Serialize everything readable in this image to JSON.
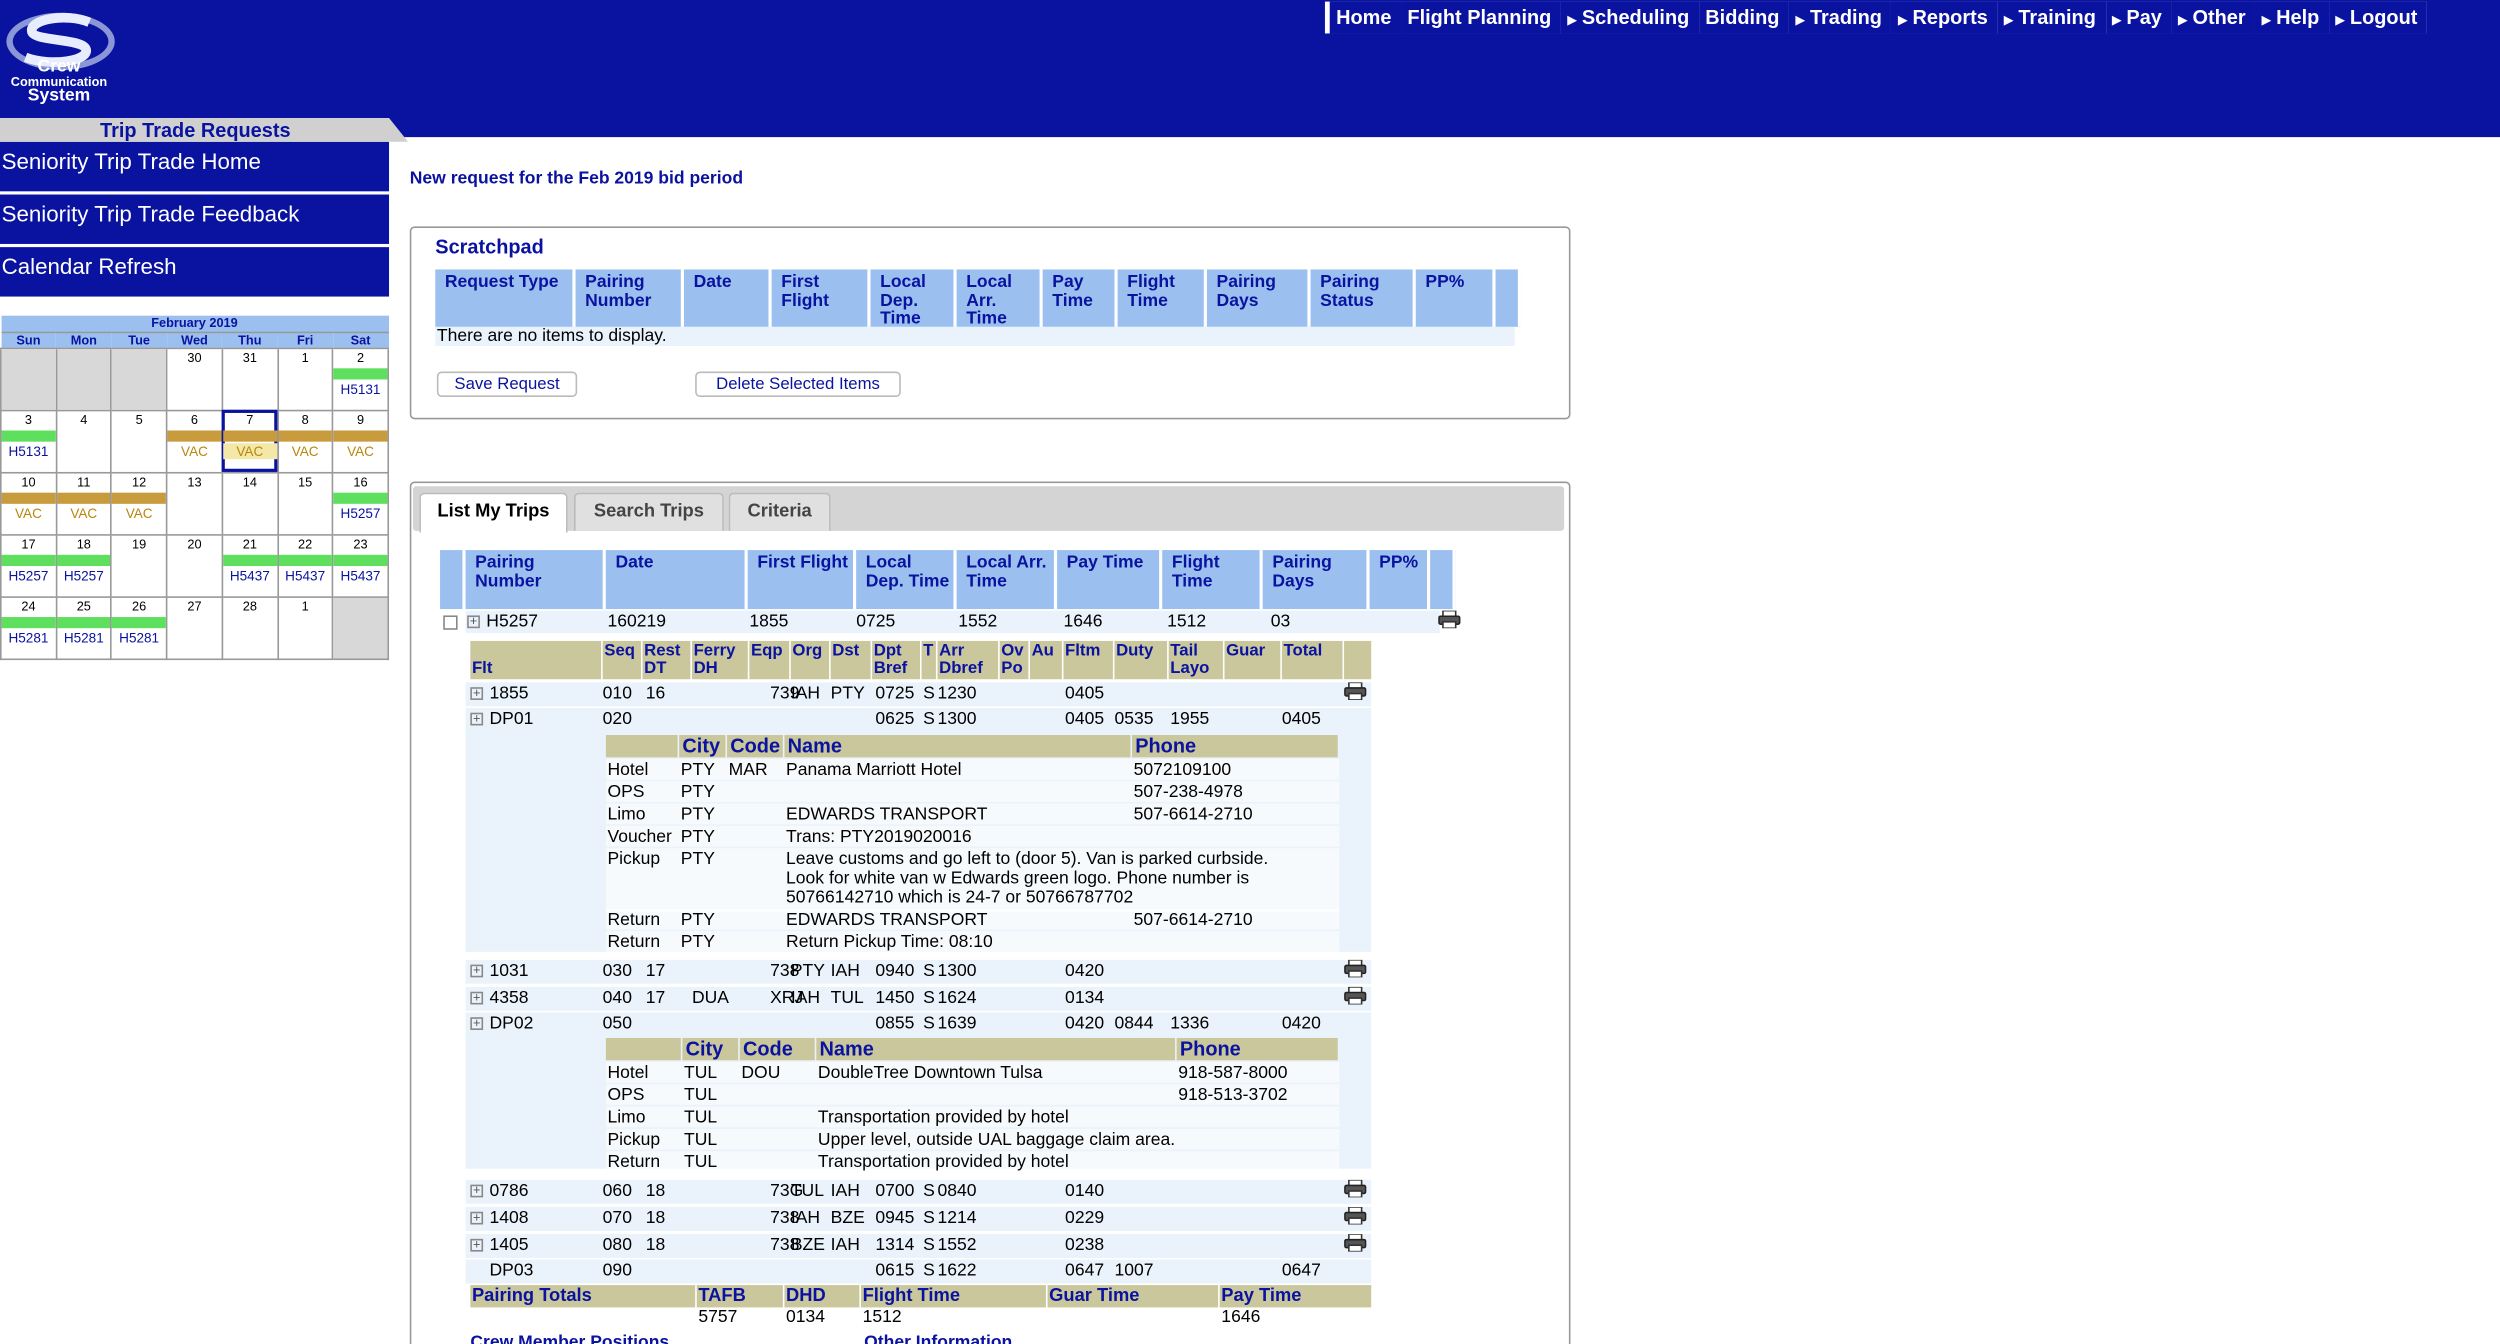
{
  "app": {
    "logo_line1": "Crew",
    "logo_line2": "Communication",
    "logo_line3": "System",
    "section_tab": "Trip Trade Requests"
  },
  "topnav": [
    {
      "label": "Home",
      "arrow": false
    },
    {
      "label": "Flight Planning",
      "arrow": false
    },
    {
      "label": "Scheduling",
      "arrow": true
    },
    {
      "label": "Bidding",
      "arrow": false
    },
    {
      "label": "Trading",
      "arrow": true
    },
    {
      "label": "Reports",
      "arrow": true
    },
    {
      "label": "Training",
      "arrow": true
    },
    {
      "label": "Pay",
      "arrow": true
    },
    {
      "label": "Other",
      "arrow": true
    },
    {
      "label": "Help",
      "arrow": true
    },
    {
      "label": "Logout",
      "arrow": true
    }
  ],
  "left_menu": [
    "Seniority Trip Trade Home",
    "Seniority Trip Trade Feedback",
    "Calendar Refresh"
  ],
  "calendar": {
    "title": "February 2019",
    "dow": [
      "Sun",
      "Mon",
      "Tue",
      "Wed",
      "Thu",
      "Fri",
      "Sat"
    ],
    "weeks": [
      [
        {
          "d": "",
          "out": true
        },
        {
          "d": "",
          "out": true
        },
        {
          "d": "",
          "out": true
        },
        {
          "d": "30"
        },
        {
          "d": "31"
        },
        {
          "d": "1"
        },
        {
          "d": "2",
          "bar": "g",
          "lbl": "H5131",
          "t": "h"
        }
      ],
      [
        {
          "d": "3",
          "bar": "g",
          "lbl": "H5131",
          "t": "h"
        },
        {
          "d": "4"
        },
        {
          "d": "5"
        },
        {
          "d": "6",
          "bar": "v",
          "lbl": "VAC",
          "t": "vac"
        },
        {
          "d": "7",
          "bar": "v",
          "lbl": "VAC",
          "t": "vac",
          "sel": true
        },
        {
          "d": "8",
          "bar": "v",
          "lbl": "VAC",
          "t": "vac"
        },
        {
          "d": "9",
          "bar": "v",
          "lbl": "VAC",
          "t": "vac"
        }
      ],
      [
        {
          "d": "10",
          "bar": "v",
          "lbl": "VAC",
          "t": "vac"
        },
        {
          "d": "11",
          "bar": "v",
          "lbl": "VAC",
          "t": "vac"
        },
        {
          "d": "12",
          "bar": "v",
          "lbl": "VAC",
          "t": "vac"
        },
        {
          "d": "13"
        },
        {
          "d": "14"
        },
        {
          "d": "15"
        },
        {
          "d": "16",
          "bar": "g",
          "lbl": "H5257",
          "t": "h"
        }
      ],
      [
        {
          "d": "17",
          "bar": "g",
          "lbl": "H5257",
          "t": "h"
        },
        {
          "d": "18",
          "bar": "g",
          "lbl": "H5257",
          "t": "h"
        },
        {
          "d": "19"
        },
        {
          "d": "20"
        },
        {
          "d": "21",
          "bar": "g",
          "lbl": "H5437",
          "t": "h"
        },
        {
          "d": "22",
          "bar": "g",
          "lbl": "H5437",
          "t": "h"
        },
        {
          "d": "23",
          "bar": "g",
          "lbl": "H5437",
          "t": "h"
        }
      ],
      [
        {
          "d": "24",
          "bar": "g",
          "lbl": "H5281",
          "t": "h"
        },
        {
          "d": "25",
          "bar": "g",
          "lbl": "H5281",
          "t": "h"
        },
        {
          "d": "26",
          "bar": "g",
          "lbl": "H5281",
          "t": "h"
        },
        {
          "d": "27"
        },
        {
          "d": "28"
        },
        {
          "d": "1"
        },
        {
          "d": "",
          "out": true
        }
      ]
    ]
  },
  "main": {
    "request_notice": "New request for the Feb 2019 bid period",
    "scratchpad": {
      "title": "Scratchpad",
      "columns": [
        "Request Type",
        "Pairing Number",
        "Date",
        "First Flight",
        "Local Dep. Time",
        "Local Arr. Time",
        "Pay Time",
        "Flight Time",
        "Pairing Days",
        "Pairing Status",
        "PP%",
        ""
      ],
      "empty_message": "There are no items to display.",
      "save_label": "Save Request",
      "delete_label": "Delete Selected Items"
    },
    "tabs": [
      "List My Trips",
      "Search Trips",
      "Criteria"
    ],
    "trip_columns": [
      "",
      "Pairing Number",
      "Date",
      "First Flight",
      "Local Dep. Time",
      "Local Arr. Time",
      "Pay Time",
      "Flight Time",
      "Pairing Days",
      "PP%",
      ""
    ],
    "trip": {
      "pairing": "H5257",
      "date": "160219",
      "first_flight": "1855",
      "dep": "0725",
      "arr": "1552",
      "pay": "1646",
      "flight": "1512",
      "days": "03"
    },
    "leg_columns": [
      "Flt",
      "Seq",
      "Rest DT",
      "Ferry DH",
      "Eqp",
      "Org",
      "Dst",
      "Dpt Bref",
      "T",
      "Arr Dbref",
      "Ov Po",
      "Au",
      "Fltm",
      "Duty",
      "Tail Layo",
      "Guar",
      "Total"
    ],
    "legs": [
      {
        "flt": "1855",
        "seq": "010",
        "rest": "16",
        "ferry": "",
        "eqp": "739",
        "org": "IAH",
        "dst": "PTY",
        "dpt": "0725",
        "t": "S",
        "arr": "1230",
        "ov": "",
        "au": "",
        "fltm": "0405",
        "duty": "",
        "tail": "",
        "guar": "",
        "total": "",
        "exp": true,
        "printer": true
      },
      {
        "flt": "DP01",
        "seq": "020",
        "rest": "",
        "ferry": "",
        "eqp": "",
        "org": "",
        "dst": "",
        "dpt": "0625",
        "t": "S",
        "arr": "1300",
        "ov": "",
        "au": "",
        "fltm": "0405",
        "duty": "0535",
        "tail": "1955",
        "guar": "",
        "total": "0405",
        "exp": true,
        "printer": false
      },
      {
        "flt": "1031",
        "seq": "030",
        "rest": "17",
        "ferry": "",
        "eqp": "738",
        "org": "PTY",
        "dst": "IAH",
        "dpt": "0940",
        "t": "S",
        "arr": "1300",
        "ov": "",
        "au": "",
        "fltm": "0420",
        "duty": "",
        "tail": "",
        "guar": "",
        "total": "",
        "exp": true,
        "printer": true
      },
      {
        "flt": "4358",
        "seq": "040",
        "rest": "17",
        "ferry": "DUA",
        "eqp": "XRJ",
        "org": "IAH",
        "dst": "TUL",
        "dpt": "1450",
        "t": "S",
        "arr": "1624",
        "ov": "",
        "au": "",
        "fltm": "0134",
        "duty": "",
        "tail": "",
        "guar": "",
        "total": "",
        "exp": true,
        "printer": true
      },
      {
        "flt": "DP02",
        "seq": "050",
        "rest": "",
        "ferry": "",
        "eqp": "",
        "org": "",
        "dst": "",
        "dpt": "0855",
        "t": "S",
        "arr": "1639",
        "ov": "",
        "au": "",
        "fltm": "0420",
        "duty": "0844",
        "tail": "1336",
        "guar": "",
        "total": "0420",
        "exp": true,
        "printer": false
      },
      {
        "flt": "0786",
        "seq": "060",
        "rest": "18",
        "ferry": "",
        "eqp": "73G",
        "org": "TUL",
        "dst": "IAH",
        "dpt": "0700",
        "t": "S",
        "arr": "0840",
        "ov": "",
        "au": "",
        "fltm": "0140",
        "duty": "",
        "tail": "",
        "guar": "",
        "total": "",
        "exp": true,
        "printer": true
      },
      {
        "flt": "1408",
        "seq": "070",
        "rest": "18",
        "ferry": "",
        "eqp": "738",
        "org": "IAH",
        "dst": "BZE",
        "dpt": "0945",
        "t": "S",
        "arr": "1214",
        "ov": "",
        "au": "",
        "fltm": "0229",
        "duty": "",
        "tail": "",
        "guar": "",
        "total": "",
        "exp": true,
        "printer": true
      },
      {
        "flt": "1405",
        "seq": "080",
        "rest": "18",
        "ferry": "",
        "eqp": "738",
        "org": "BZE",
        "dst": "IAH",
        "dpt": "1314",
        "t": "S",
        "arr": "1552",
        "ov": "",
        "au": "",
        "fltm": "0238",
        "duty": "",
        "tail": "",
        "guar": "",
        "total": "",
        "exp": true,
        "printer": true
      },
      {
        "flt": "DP03",
        "seq": "090",
        "rest": "",
        "ferry": "",
        "eqp": "",
        "org": "",
        "dst": "",
        "dpt": "0615",
        "t": "S",
        "arr": "1622",
        "ov": "",
        "au": "",
        "fltm": "0647",
        "duty": "1007",
        "tail": "",
        "guar": "",
        "total": "0647",
        "exp": false,
        "printer": false
      }
    ],
    "layover_columns": [
      "",
      "City",
      "Code",
      "Name",
      "Phone"
    ],
    "layover1": [
      {
        "type": "Hotel",
        "city": "PTY",
        "code": "MAR",
        "name": "Panama Marriott Hotel",
        "phone": "5072109100"
      },
      {
        "type": "OPS",
        "city": "PTY",
        "code": "",
        "name": "",
        "phone": "507-238-4978"
      },
      {
        "type": "Limo",
        "city": "PTY",
        "code": "",
        "name": "EDWARDS TRANSPORT",
        "phone": "507-6614-2710"
      },
      {
        "type": "Voucher",
        "city": "PTY",
        "code": "",
        "name": "Trans: PTY2019020016",
        "phone": ""
      },
      {
        "type": "Pickup",
        "city": "PTY",
        "code": "",
        "name": "Leave customs and go left to (door 5). Van is parked curbside.",
        "name2": "Look for white van w Edwards green logo. Phone number is",
        "name3": "50766142710 which is 24-7 or 50766787702",
        "phone": ""
      },
      {
        "type": "Return",
        "city": "PTY",
        "code": "",
        "name": "EDWARDS TRANSPORT",
        "phone": "507-6614-2710"
      },
      {
        "type": "Return",
        "city": "PTY",
        "code": "",
        "name": "Return Pickup Time: 08:10",
        "phone": ""
      }
    ],
    "layover2": [
      {
        "type": "Hotel",
        "city": "TUL",
        "code": "DOU",
        "name": "DoubleTree Downtown Tulsa",
        "phone": "918-587-8000"
      },
      {
        "type": "OPS",
        "city": "TUL",
        "code": "",
        "name": "",
        "phone": "918-513-3702"
      },
      {
        "type": "Limo",
        "city": "TUL",
        "code": "",
        "name": "Transportation provided by hotel",
        "phone": ""
      },
      {
        "type": "Pickup",
        "city": "TUL",
        "code": "",
        "name": "Upper level, outside UAL baggage claim area.",
        "phone": ""
      },
      {
        "type": "Return",
        "city": "TUL",
        "code": "",
        "name": "Transportation provided by hotel",
        "phone": ""
      }
    ],
    "totals": {
      "labels": [
        "Pairing Totals",
        "TAFB",
        "DHD",
        "Flight Time",
        "Guar Time",
        "Pay Time"
      ],
      "values": [
        "",
        "5757",
        "0134",
        "1512",
        "",
        "1646"
      ]
    },
    "footer_labels": [
      "Crew Member Positions",
      "Other Information"
    ]
  }
}
